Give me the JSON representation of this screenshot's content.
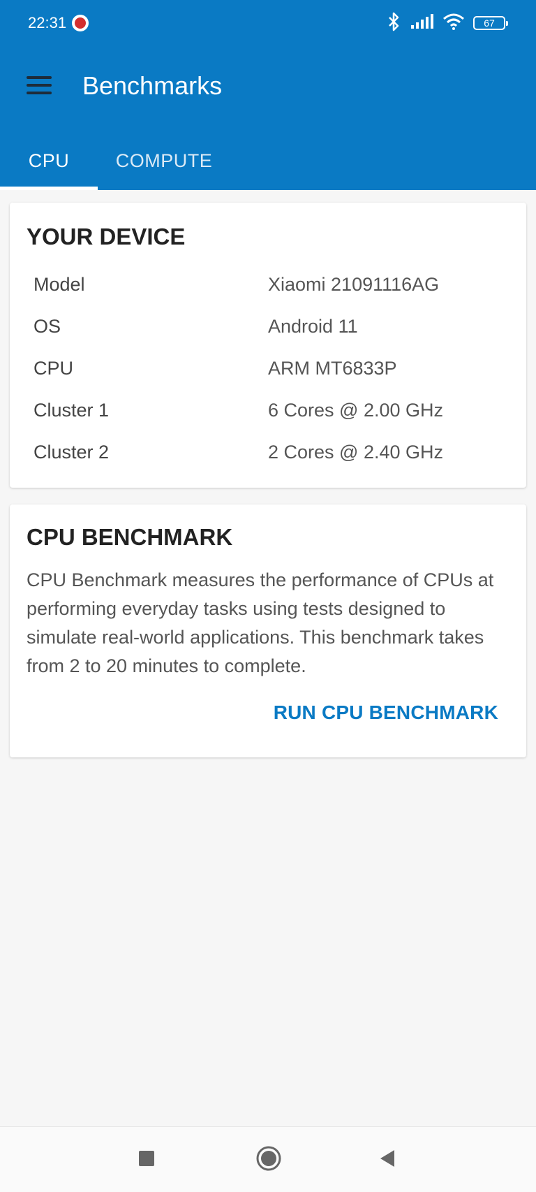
{
  "status_bar": {
    "time": "22:31",
    "battery": "67",
    "icons": [
      "notification-icon",
      "bluetooth-icon",
      "signal-icon",
      "wifi-icon",
      "battery-icon"
    ]
  },
  "app_bar": {
    "title": "Benchmarks",
    "menu_icon": "hamburger-menu-icon"
  },
  "tabs": [
    {
      "label": "CPU",
      "active": true
    },
    {
      "label": "COMPUTE",
      "active": false
    }
  ],
  "device_card": {
    "title": "YOUR DEVICE",
    "rows": [
      {
        "label": "Model",
        "value": "Xiaomi 21091116AG"
      },
      {
        "label": "OS",
        "value": "Android 11"
      },
      {
        "label": "CPU",
        "value": "ARM MT6833P"
      },
      {
        "label": "Cluster 1",
        "value": "6 Cores @ 2.00 GHz"
      },
      {
        "label": "Cluster 2",
        "value": "2 Cores @ 2.40 GHz"
      }
    ]
  },
  "benchmark_card": {
    "title": "CPU BENCHMARK",
    "description": "CPU Benchmark measures the performance of CPUs at performing everyday tasks using tests designed to simulate real-world applications. This benchmark takes from 2 to 20 minutes to complete.",
    "action_label": "RUN CPU BENCHMARK"
  },
  "nav_bar": {
    "icons": [
      "recents-icon",
      "home-icon",
      "back-icon"
    ]
  },
  "colors": {
    "primary": "#0a7ac4",
    "background": "#f6f6f6",
    "card": "#ffffff"
  }
}
